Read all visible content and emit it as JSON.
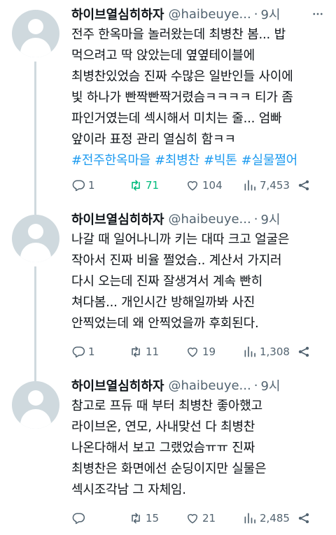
{
  "colors": {
    "text": "#0f1419",
    "secondary": "#536471",
    "link": "#1d9bf0",
    "retweeted": "#00ba7c",
    "avatar_bg": "#cfd9de"
  },
  "tweets": [
    {
      "name": "하이브열심히하자",
      "handle": "@haibeuye...",
      "dot": "·",
      "time": "9시",
      "lines": [
        "전주 한옥마을 놀러왔는데 최병찬 봄... 밥",
        "먹으려고 딱 앉았는데 옆옆테이블에",
        "최병찬있었슴 진짜 수많은 일반인들 사이에",
        "빛 하나가 빤짝빤짝거렸슴ㅋㅋㅋㅋ 티가 좀",
        "파인거였는데 섹시해서 미치는 줄... 엄빠",
        "앞이라 표정 관리 열심히 함ㅋㅋ"
      ],
      "hashtags": [
        "#전주한옥마을",
        "#최병찬",
        "#빅톤",
        "#실물쩔어"
      ],
      "replies": "1",
      "retweets": "71",
      "likes": "104",
      "views": "7,453"
    },
    {
      "name": "하이브열심히하자",
      "handle": "@haibeuye...",
      "dot": "·",
      "time": "9시",
      "lines": [
        "나갈 때 일어나니까 키는 대따 크고 얼굴은",
        "작아서 진짜 비율 쩔었슴.. 계산서 가지러",
        "다시 오는데 진짜 잘생겨서 계속 빤히",
        "쳐다봄... 개인시간 방해일까봐 사진",
        "안찍었는데 왜 안찍었을까 후회된다."
      ],
      "replies": "1",
      "retweets": "11",
      "likes": "19",
      "views": "1,308"
    },
    {
      "name": "하이브열심히하자",
      "handle": "@haibeuye...",
      "dot": "·",
      "time": "9시",
      "lines": [
        "참고로 프듀 때 부터 최병찬 좋아했고",
        "라이브온, 연모, 사내맞선 다 최병찬",
        "나온다해서 보고 그랬었슴ㅠㅠ 진짜",
        "최병찬은 화면에선 순딩이지만 실물은",
        "섹시조각남 그 자체임."
      ],
      "retweets": "15",
      "likes": "21",
      "views": "2,485"
    }
  ],
  "icons": {
    "avatar": "default-profile-icon",
    "more": "more-dots-icon",
    "reply": "reply-bubble-icon",
    "retweet": "retweet-arrows-icon",
    "like": "heart-outline-icon",
    "views": "bar-chart-views-icon",
    "share": "share-nodes-icon"
  }
}
